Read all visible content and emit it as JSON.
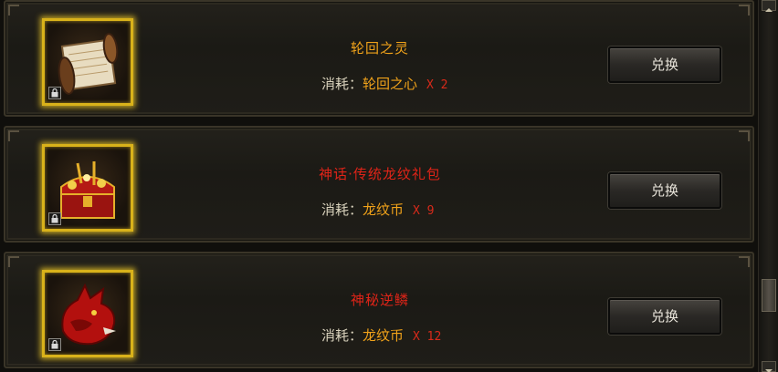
{
  "cost_label": "消耗：",
  "items": [
    {
      "name": "轮回之灵",
      "name_color": "#f0a21a",
      "currency": "轮回之心",
      "qty": "X 2",
      "icon": "scroll-icon",
      "button": "兑换"
    },
    {
      "name": "神话·传统龙纹礼包",
      "name_color": "#e02418",
      "currency": "龙纹币",
      "qty": "X 9",
      "icon": "treasure-chest-icon",
      "button": "兑换"
    },
    {
      "name": "神秘逆鳞",
      "name_color": "#e02418",
      "currency": "龙纹币",
      "qty": "X 12",
      "icon": "red-dragon-icon",
      "button": "兑换"
    }
  ],
  "colors": {
    "slot_border": "#d9b21a",
    "currency": "#f0a21a",
    "quantity": "#d82a1a"
  }
}
